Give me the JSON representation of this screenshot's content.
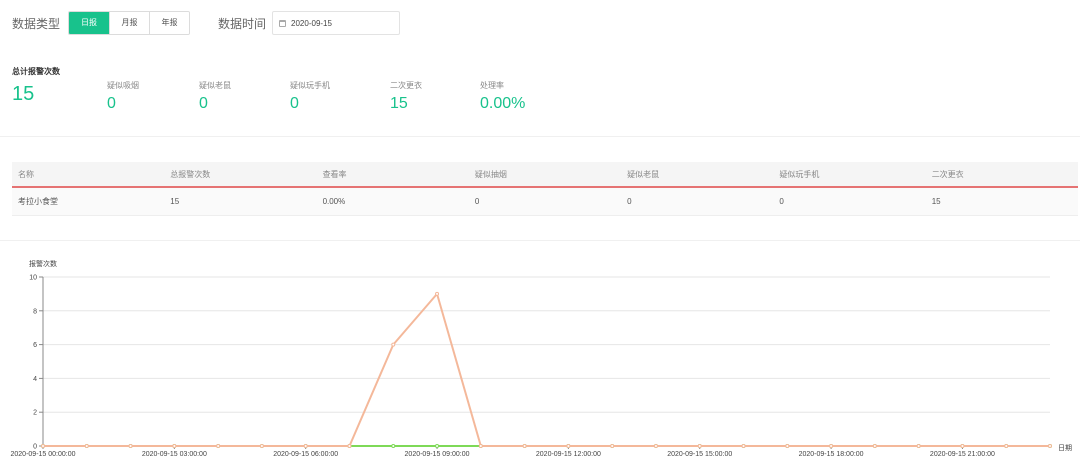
{
  "filters": {
    "type_label": "数据类型",
    "periods": [
      {
        "label": "日报",
        "active": true
      },
      {
        "label": "月报",
        "active": false
      },
      {
        "label": "年报",
        "active": false
      }
    ],
    "date_label": "数据时间",
    "date_value": "2020-09-15"
  },
  "stats": {
    "total": {
      "label": "总计报警次数",
      "value": "15"
    },
    "items": [
      {
        "label": "疑似吸烟",
        "value": "0"
      },
      {
        "label": "疑似老鼠",
        "value": "0"
      },
      {
        "label": "疑似玩手机",
        "value": "0"
      },
      {
        "label": "二次更衣",
        "value": "15"
      },
      {
        "label": "处理率",
        "value": "0.00%"
      }
    ]
  },
  "table": {
    "headers": [
      "名称",
      "总报警次数",
      "查看率",
      "疑似抽烟",
      "疑似老鼠",
      "疑似玩手机",
      "二次更衣"
    ],
    "rows": [
      [
        "考拉小食堂",
        "15",
        "0.00%",
        "0",
        "0",
        "0",
        "15"
      ]
    ]
  },
  "chart_data": {
    "type": "line",
    "ylabel": "报警次数",
    "xlabel": "日期",
    "ylim": [
      0,
      10
    ],
    "yticks": [
      0,
      2,
      4,
      6,
      8,
      10
    ],
    "x_tick_labels": [
      "2020-09-15 00:00:00",
      "2020-09-15 03:00:00",
      "2020-09-15 06:00:00",
      "2020-09-15 09:00:00",
      "2020-09-15 12:00:00",
      "2020-09-15 15:00:00",
      "2020-09-15 18:00:00",
      "2020-09-15 21:00:00"
    ],
    "x_hours": [
      0,
      1,
      2,
      3,
      4,
      5,
      6,
      7,
      8,
      9,
      10,
      11,
      12,
      13,
      14,
      15,
      16,
      17,
      18,
      19,
      20,
      21,
      22,
      23
    ],
    "grid": true,
    "series": [
      {
        "color": "#f4b89a",
        "values": [
          0,
          0,
          0,
          0,
          0,
          0,
          0,
          0,
          6,
          9,
          0,
          0,
          0,
          0,
          0,
          0,
          0,
          0,
          0,
          0,
          0,
          0,
          0,
          0
        ]
      },
      {
        "color": "#7ed957",
        "values": [
          0,
          0,
          0,
          0,
          0,
          0,
          0,
          0,
          0,
          0,
          0,
          0,
          0,
          0,
          0,
          0,
          0,
          0,
          0,
          0,
          0,
          0,
          0,
          0
        ]
      }
    ]
  }
}
